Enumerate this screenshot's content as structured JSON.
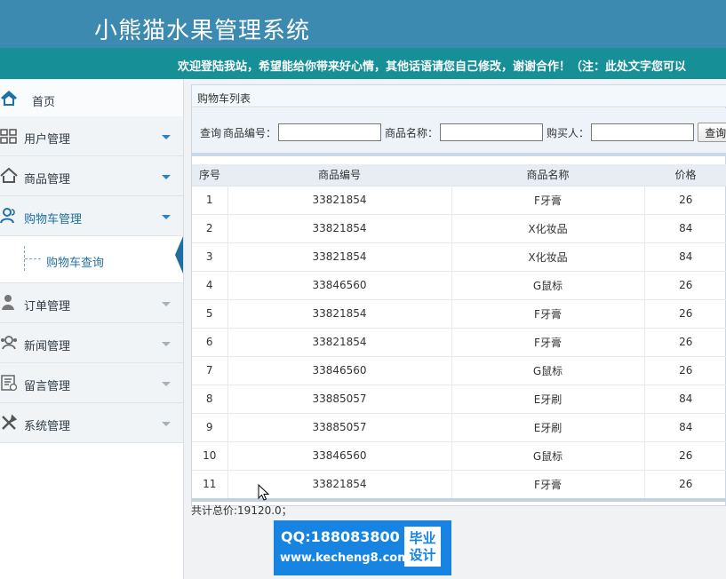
{
  "header": {
    "title": "小熊猫水果管理系统",
    "welcome": "欢迎登陆我站，希望能给你带来好心情，其他话语请您自己修改，谢谢合作！（注：此处文字您可以"
  },
  "sidebar": {
    "items": [
      {
        "label": "首页",
        "icon": "home-icon"
      },
      {
        "label": "用户管理",
        "icon": "users-grid-icon"
      },
      {
        "label": "商品管理",
        "icon": "house-icon"
      },
      {
        "label": "购物车管理",
        "icon": "user-group-icon"
      },
      {
        "label": "订单管理",
        "icon": "person-icon"
      },
      {
        "label": "新闻管理",
        "icon": "news-icon"
      },
      {
        "label": "留言管理",
        "icon": "message-icon"
      },
      {
        "label": "系统管理",
        "icon": "tools-icon"
      }
    ],
    "submenu": {
      "label": "购物车查询"
    }
  },
  "main": {
    "panel_title": "购物车列表",
    "search": {
      "query_label": "查询",
      "product_no_label": "商品编号：",
      "product_name_label": "商品名称：",
      "buyer_label": "购买人：",
      "product_no_value": "",
      "product_name_value": "",
      "buyer_value": "",
      "button": "查询"
    },
    "table": {
      "columns": [
        "序号",
        "商品编号",
        "商品名称",
        "价格"
      ],
      "rows": [
        [
          "1",
          "33821854",
          "F牙膏",
          "26"
        ],
        [
          "2",
          "33821854",
          "X化妆品",
          "84"
        ],
        [
          "3",
          "33821854",
          "X化妆品",
          "84"
        ],
        [
          "4",
          "33846560",
          "G鼠标",
          "26"
        ],
        [
          "5",
          "33821854",
          "F牙膏",
          "26"
        ],
        [
          "6",
          "33821854",
          "F牙膏",
          "26"
        ],
        [
          "7",
          "33846560",
          "G鼠标",
          "26"
        ],
        [
          "8",
          "33885057",
          "E牙刷",
          "84"
        ],
        [
          "9",
          "33885057",
          "E牙刷",
          "84"
        ],
        [
          "10",
          "33846560",
          "G鼠标",
          "26"
        ],
        [
          "11",
          "33821854",
          "F牙膏",
          "26"
        ]
      ]
    },
    "total": "共计总价:19120.0；"
  },
  "watermark": {
    "qq": "QQ:188083800",
    "url": "www.kecheng8.com",
    "badge_line1": "毕业",
    "badge_line2": "设计"
  },
  "colors": {
    "header": "#3d8ab1",
    "marquee": "#168f96",
    "active": "#1e6f9d",
    "watermark": "#1684e0"
  }
}
